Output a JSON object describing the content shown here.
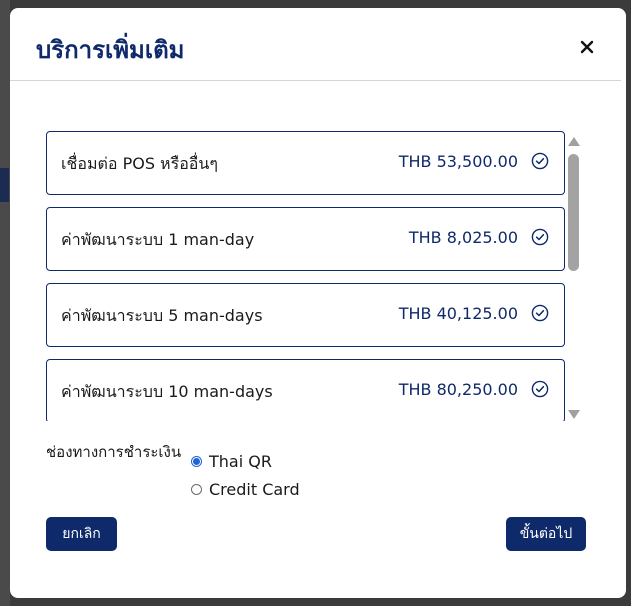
{
  "modal": {
    "title": "บริการเพิ่มเติม"
  },
  "services": [
    {
      "name": "เชื่อมต่อ POS หรืออื่นๆ",
      "price": "THB 53,500.00"
    },
    {
      "name": "ค่าพัฒนาระบบ 1 man-day",
      "price": "THB 8,025.00"
    },
    {
      "name": "ค่าพัฒนาระบบ 5 man-days",
      "price": "THB 40,125.00"
    },
    {
      "name": "ค่าพัฒนาระบบ 10 man-days",
      "price": "THB 80,250.00"
    }
  ],
  "payment": {
    "label": "ช่องทางการชำระเงิน",
    "options": [
      {
        "label": "Thai QR",
        "selected": true
      },
      {
        "label": "Credit Card",
        "selected": false
      }
    ]
  },
  "buttons": {
    "cancel": "ยกเลิก",
    "next": "ขั้นต่อไป"
  },
  "colors": {
    "brand": "#0f2a6b",
    "radio": "#1f63d6"
  }
}
